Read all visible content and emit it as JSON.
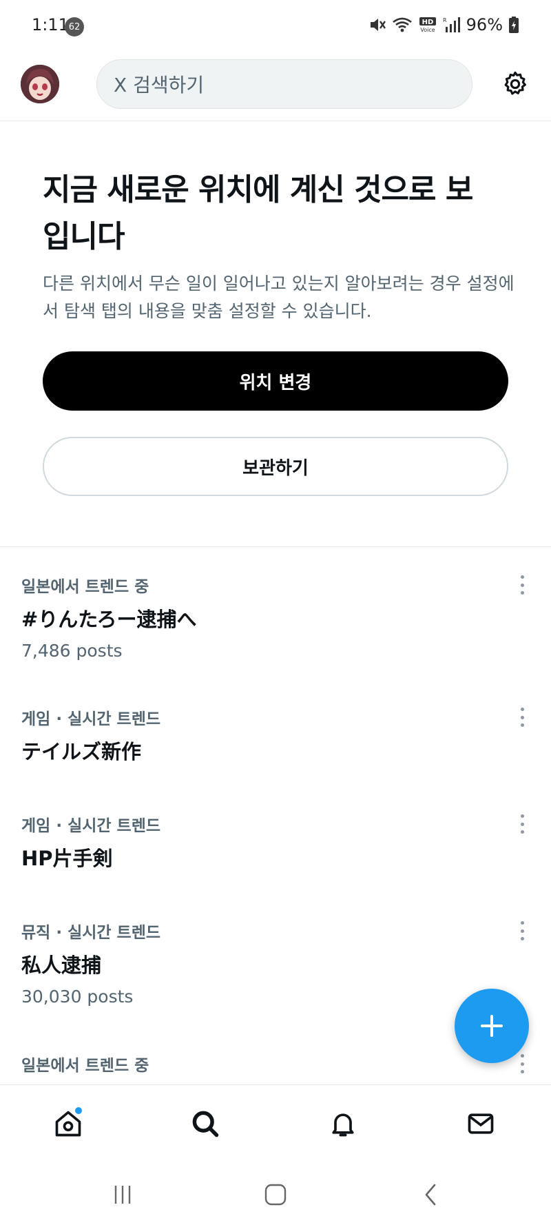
{
  "status_bar": {
    "time": "1:11",
    "notification_count": "62",
    "battery": "96%"
  },
  "topbar": {
    "search_placeholder": "X 검색하기"
  },
  "location_card": {
    "title": "지금 새로운 위치에 계신 것으로 보입니다",
    "description": "다른 위치에서 무슨 일이 일어나고 있는지 알아보려는 경우 설정에서 탐색 탭의 내용을 맞춤 설정할 수 있습니다.",
    "change_button": "위치 변경",
    "keep_button": "보관하기"
  },
  "trends": [
    {
      "meta": "일본에서 트렌드 중",
      "name": "#りんたろー逮捕へ",
      "posts": "7,486 posts"
    },
    {
      "meta": "게임 · 실시간 트렌드",
      "name": "テイルズ新作",
      "posts": ""
    },
    {
      "meta": "게임 · 실시간 트렌드",
      "name": "HP片手剣",
      "posts": ""
    },
    {
      "meta": "뮤직 · 실시간 트렌드",
      "name": "私人逮捕",
      "posts": "30,030 posts"
    },
    {
      "meta": "일본에서 트렌드 중",
      "name": "",
      "posts": ""
    }
  ],
  "colors": {
    "accent": "#1d9bf0",
    "text_primary": "#0f1419",
    "text_secondary": "#536471",
    "primary_button": "#000000"
  },
  "icons": {
    "settings": "gear-icon",
    "fab": "plus-icon",
    "nav": [
      "home-icon",
      "search-icon",
      "bell-icon",
      "mail-icon"
    ]
  }
}
